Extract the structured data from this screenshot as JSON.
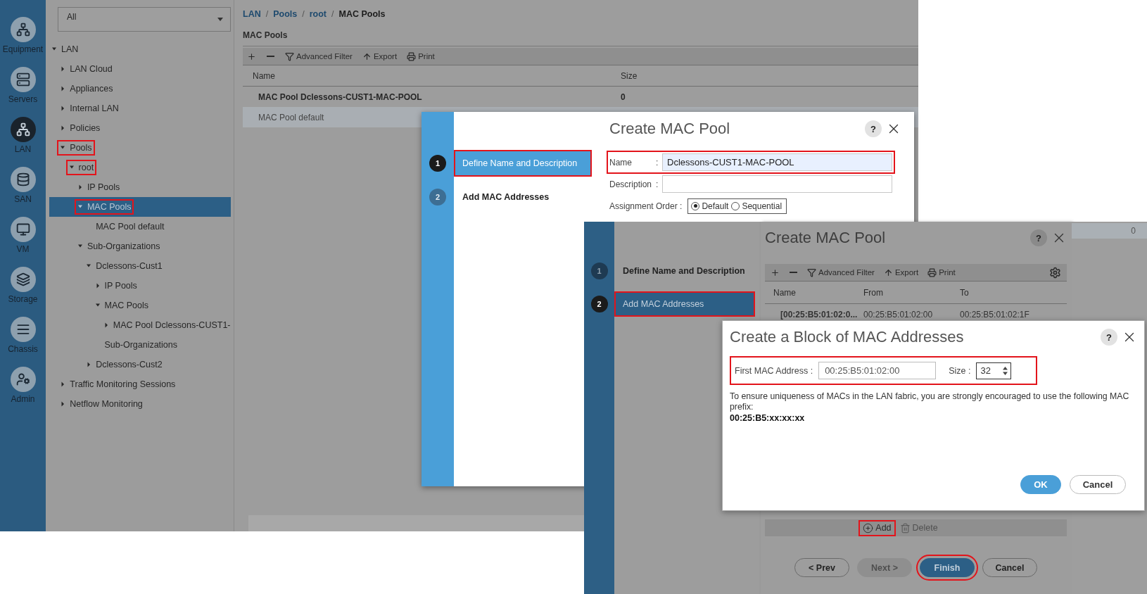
{
  "nav_rail": [
    {
      "label": "Equipment",
      "selected": false
    },
    {
      "label": "Servers",
      "selected": false
    },
    {
      "label": "LAN",
      "selected": true
    },
    {
      "label": "SAN",
      "selected": false
    },
    {
      "label": "VM",
      "selected": false
    },
    {
      "label": "Storage",
      "selected": false
    },
    {
      "label": "Chassis",
      "selected": false
    },
    {
      "label": "Admin",
      "selected": false
    }
  ],
  "tree_filter": {
    "value": "All"
  },
  "tree": [
    {
      "label": "LAN",
      "expanded": true,
      "selected": false,
      "highlighted": false,
      "children": [
        {
          "label": "LAN Cloud",
          "expanded": false,
          "selected": false,
          "highlighted": false
        },
        {
          "label": "Appliances",
          "expanded": false,
          "selected": false,
          "highlighted": false
        },
        {
          "label": "Internal LAN",
          "expanded": false,
          "selected": false,
          "highlighted": false
        },
        {
          "label": "Policies",
          "expanded": false,
          "selected": false,
          "highlighted": false
        },
        {
          "label": "Pools",
          "expanded": true,
          "selected": false,
          "highlighted": true,
          "children": [
            {
              "label": "root",
              "expanded": true,
              "selected": false,
              "highlighted": true,
              "children": [
                {
                  "label": "IP Pools",
                  "expanded": false,
                  "selected": false,
                  "highlighted": false
                },
                {
                  "label": "MAC Pools",
                  "expanded": true,
                  "selected": true,
                  "highlighted": true,
                  "children": [
                    {
                      "label": "MAC Pool default",
                      "selected": false,
                      "highlighted": false
                    }
                  ]
                },
                {
                  "label": "Sub-Organizations",
                  "expanded": true,
                  "selected": false,
                  "highlighted": false,
                  "children": [
                    {
                      "label": "Dclessons-Cust1",
                      "expanded": true,
                      "selected": false,
                      "highlighted": false,
                      "children": [
                        {
                          "label": "IP Pools",
                          "expanded": false,
                          "selected": false,
                          "highlighted": false
                        },
                        {
                          "label": "MAC Pools",
                          "expanded": true,
                          "selected": false,
                          "highlighted": false,
                          "children": [
                            {
                              "label": "MAC Pool Dclessons-CUST1-",
                              "expanded": false,
                              "selected": false,
                              "highlighted": false
                            }
                          ]
                        },
                        {
                          "label": "Sub-Organizations",
                          "selected": false,
                          "highlighted": false
                        }
                      ]
                    },
                    {
                      "label": "Dclessons-Cust2",
                      "expanded": false,
                      "selected": false,
                      "highlighted": false
                    }
                  ]
                }
              ]
            }
          ]
        },
        {
          "label": "Traffic Monitoring Sessions",
          "expanded": false,
          "selected": false,
          "highlighted": false
        },
        {
          "label": "Netflow Monitoring",
          "expanded": false,
          "selected": false,
          "highlighted": false
        }
      ]
    }
  ],
  "breadcrumb": {
    "separator": "/",
    "items": [
      {
        "label": "LAN",
        "current": false
      },
      {
        "label": "Pools",
        "current": false
      },
      {
        "label": "root",
        "current": false
      },
      {
        "label": "MAC Pools",
        "current": true
      }
    ]
  },
  "section_title": "MAC Pools",
  "toolbar": [
    {
      "kind": "add"
    },
    {
      "kind": "remove"
    },
    {
      "kind": "filter",
      "label": "Advanced Filter"
    },
    {
      "kind": "export",
      "label": "Export"
    },
    {
      "kind": "print",
      "label": "Print"
    }
  ],
  "table": {
    "columns": [
      "Name",
      "Size"
    ],
    "rows": [
      {
        "cells": [
          "MAC Pool Dclessons-CUST1-MAC-POOL",
          "0"
        ],
        "selected": false,
        "bold": true
      },
      {
        "cells": [
          "MAC Pool default"
        ],
        "selected": true,
        "bold": false
      }
    ]
  },
  "create_pool_dialog": {
    "title": "Create MAC Pool",
    "help": "?",
    "steps": [
      {
        "number": "1",
        "label": "Define Name and Description",
        "selected": true,
        "highlighted": true
      },
      {
        "number": "2",
        "label": "Add MAC Addresses",
        "selected": false,
        "highlighted": false
      }
    ],
    "fields": [
      {
        "label": "Name",
        "separator": ":",
        "value": "Dclessons-CUST1-MAC-POOL",
        "highlighted": true
      },
      {
        "label": "Description",
        "separator": ":",
        "highlighted": false
      }
    ],
    "assignment": {
      "label": "Assignment Order :",
      "options": [
        {
          "label": "Default",
          "selected": true
        },
        {
          "label": "Sequential",
          "selected": false
        }
      ]
    }
  },
  "add_addresses_dialog": {
    "title": "Create MAC Pool",
    "help": "?",
    "steps": [
      {
        "number": "1",
        "label": "Define Name and Description",
        "selected": false,
        "highlighted": false
      },
      {
        "number": "2",
        "label": "Add MAC Addresses",
        "selected": true,
        "highlighted": true
      }
    ],
    "toolbar": [
      {
        "kind": "add"
      },
      {
        "kind": "remove"
      },
      {
        "kind": "filter",
        "label": "Advanced Filter"
      },
      {
        "kind": "export",
        "label": "Export"
      },
      {
        "kind": "print",
        "label": "Print"
      },
      {
        "kind": "settings"
      }
    ],
    "table": {
      "columns": [
        "Name",
        "From",
        "To"
      ],
      "rows": [
        {
          "cells": [
            "[00:25:B5:01:02:0...",
            "00:25:B5:01:02:00",
            "00:25:B5:01:02:1F"
          ]
        }
      ]
    },
    "row_actions": [
      {
        "kind": "add",
        "label": "Add",
        "disabled": false,
        "highlighted": true
      },
      {
        "kind": "delete",
        "label": "Delete",
        "disabled": true,
        "highlighted": false
      }
    ],
    "buttons": [
      {
        "label": "< Prev",
        "kind": "default",
        "disabled": false,
        "highlighted": false
      },
      {
        "label": "Next >",
        "kind": "default",
        "disabled": true,
        "highlighted": false
      },
      {
        "label": "Finish",
        "kind": "primary",
        "disabled": false,
        "highlighted": true
      },
      {
        "label": "Cancel",
        "kind": "default",
        "disabled": false,
        "highlighted": false
      }
    ]
  },
  "background_value": "0",
  "block_dialog": {
    "title": "Create a Block of MAC Addresses",
    "help": "?",
    "fields_highlighted": true,
    "first_address": {
      "label": "First MAC Address :",
      "value": "00:25:B5:01:02:00"
    },
    "size": {
      "label": "Size :",
      "value": "32"
    },
    "note": "To ensure uniqueness of MACs in the LAN fabric, you are strongly encouraged to use the following MAC prefix:",
    "prefix": "00:25:B5:xx:xx:xx",
    "buttons": [
      {
        "label": "OK",
        "kind": "primary"
      },
      {
        "label": "Cancel",
        "kind": "default"
      }
    ]
  }
}
